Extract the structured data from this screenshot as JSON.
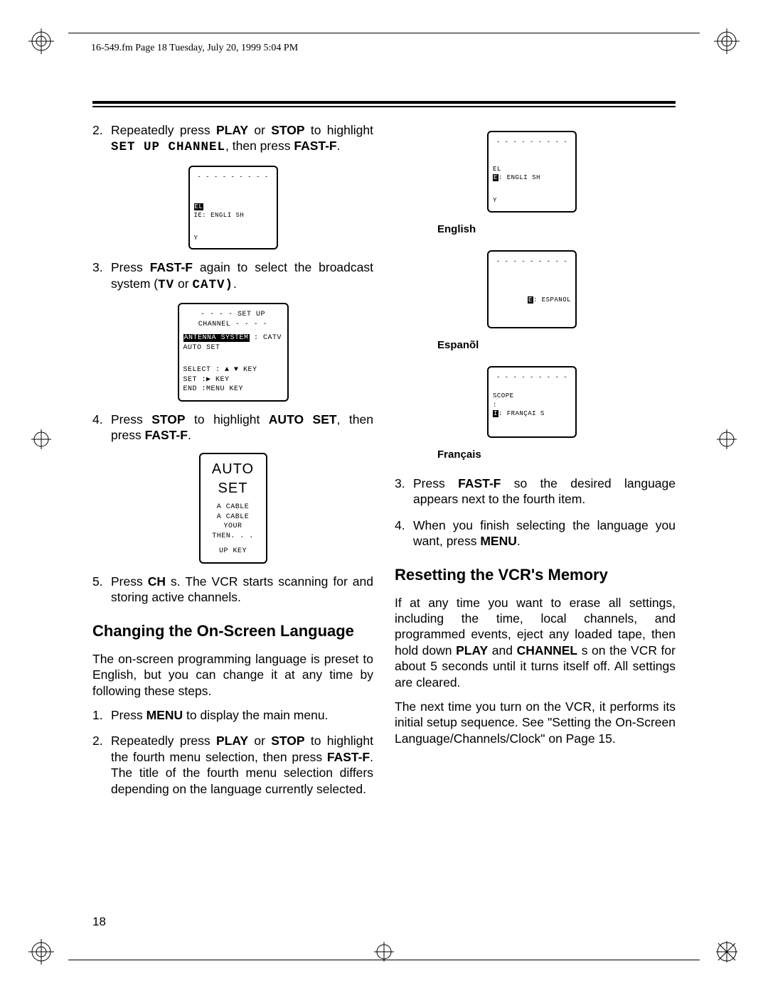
{
  "header": "16-549.fm  Page 18  Tuesday, July 20, 1999  5:04 PM",
  "page_number": "18",
  "left": {
    "step2": {
      "n": "2.",
      "text_a": "Repeatedly press ",
      "b1": "PLAY",
      "text_b": " or ",
      "b2": "STOP",
      "text_c": " to highlight ",
      "m1": "SET UP CHANNEL",
      "text_d": ", then press ",
      "b3": "FAST-F",
      "text_e": "."
    },
    "screen1": {
      "dashes": "- - - - - - - - -",
      "line1a": "EL",
      "line1b": "IE: ENGLI SH",
      "line2": "Y"
    },
    "step3": {
      "n": "3.",
      "a": "Press ",
      "b": "FAST-F",
      "c": " again to select the broadcast system (",
      "m": "TV",
      "d": " or ",
      "m2": "CATV)",
      "e": "."
    },
    "screen2": {
      "title": "- - - - SET  UP  CHANNEL - - - -",
      "l1a": "ANTENNA  SYSTEM",
      "l1b": "  :  CATV",
      "l2": "AUTO  SET",
      "l3": "SELECT : ▲ ▼  KEY",
      "l4": "SET        :▶  KEY",
      "l5": "END       :MENU  KEY"
    },
    "step4": {
      "n": "4.",
      "a": "Press ",
      "b": "STOP",
      "c": " to highlight ",
      "b2": "AUTO SET",
      "d": ", then press ",
      "b3": "FAST-F",
      "e": "."
    },
    "screen3": {
      "big": "AUTO SET",
      "l1": "A  CABLE",
      "l2": " A   CABLE",
      "l3": "YOUR",
      "l4": "THEN. . .",
      "l5": "UP  KEY"
    },
    "step5": {
      "n": "5.",
      "a": "Press ",
      "b": "CH",
      "c": " s. The VCR starts scanning for and storing active channels."
    },
    "h2": "Changing the On-Screen Language",
    "p1": "The on-screen programming language is preset to English, but you can change it at any time by following these steps.",
    "s1": {
      "n": "1.",
      "a": "Press ",
      "b": "MENU",
      "c": " to display the main menu."
    },
    "s2": {
      "n": "2.",
      "a": "Repeatedly press ",
      "b": "PLAY",
      "c": " or ",
      "b2": "STOP",
      "d": " to highlight the fourth menu selection, then press ",
      "b3": "FAST-F",
      "e": ". The title of the fourth menu selection differs depending on the language currently selected."
    }
  },
  "right": {
    "fig1": {
      "dashes": "- - - - - - - - -",
      "l1": "EL",
      "l2": "E: ENGLI SH",
      "l3": "Y",
      "caption": "English"
    },
    "fig2": {
      "dashes": "- - - - - - - - -",
      "l1": "E: ESPANOL",
      "caption": "Espanõl"
    },
    "fig3": {
      "dashes": "- - - - - - - - -",
      "l0": "SCOPE",
      "l0b": ":",
      "l1": "I: FRANÇAI S",
      "caption": "Français"
    },
    "s3": {
      "n": "3.",
      "a": "Press ",
      "b": "FAST-F",
      "c": " so the desired language appears next to the fourth item."
    },
    "s4": {
      "n": "4.",
      "a": "When you finish selecting the language you want, press ",
      "b": "MENU",
      "c": "."
    },
    "h2": "Resetting the VCR's Memory",
    "p1a": "If at any time you want to erase all settings, including the time, local channels, and programmed events, eject any loaded tape, then hold down ",
    "p1b": "PLAY",
    "p1c": " and ",
    "p1d": "CHANNEL",
    "p1e": " s on the VCR for about 5 seconds until it turns itself off. All settings are cleared.",
    "p2": "The next time you turn on the VCR, it performs its initial setup sequence. See \"Setting the On-Screen Language/Channels/Clock\" on Page 15."
  }
}
